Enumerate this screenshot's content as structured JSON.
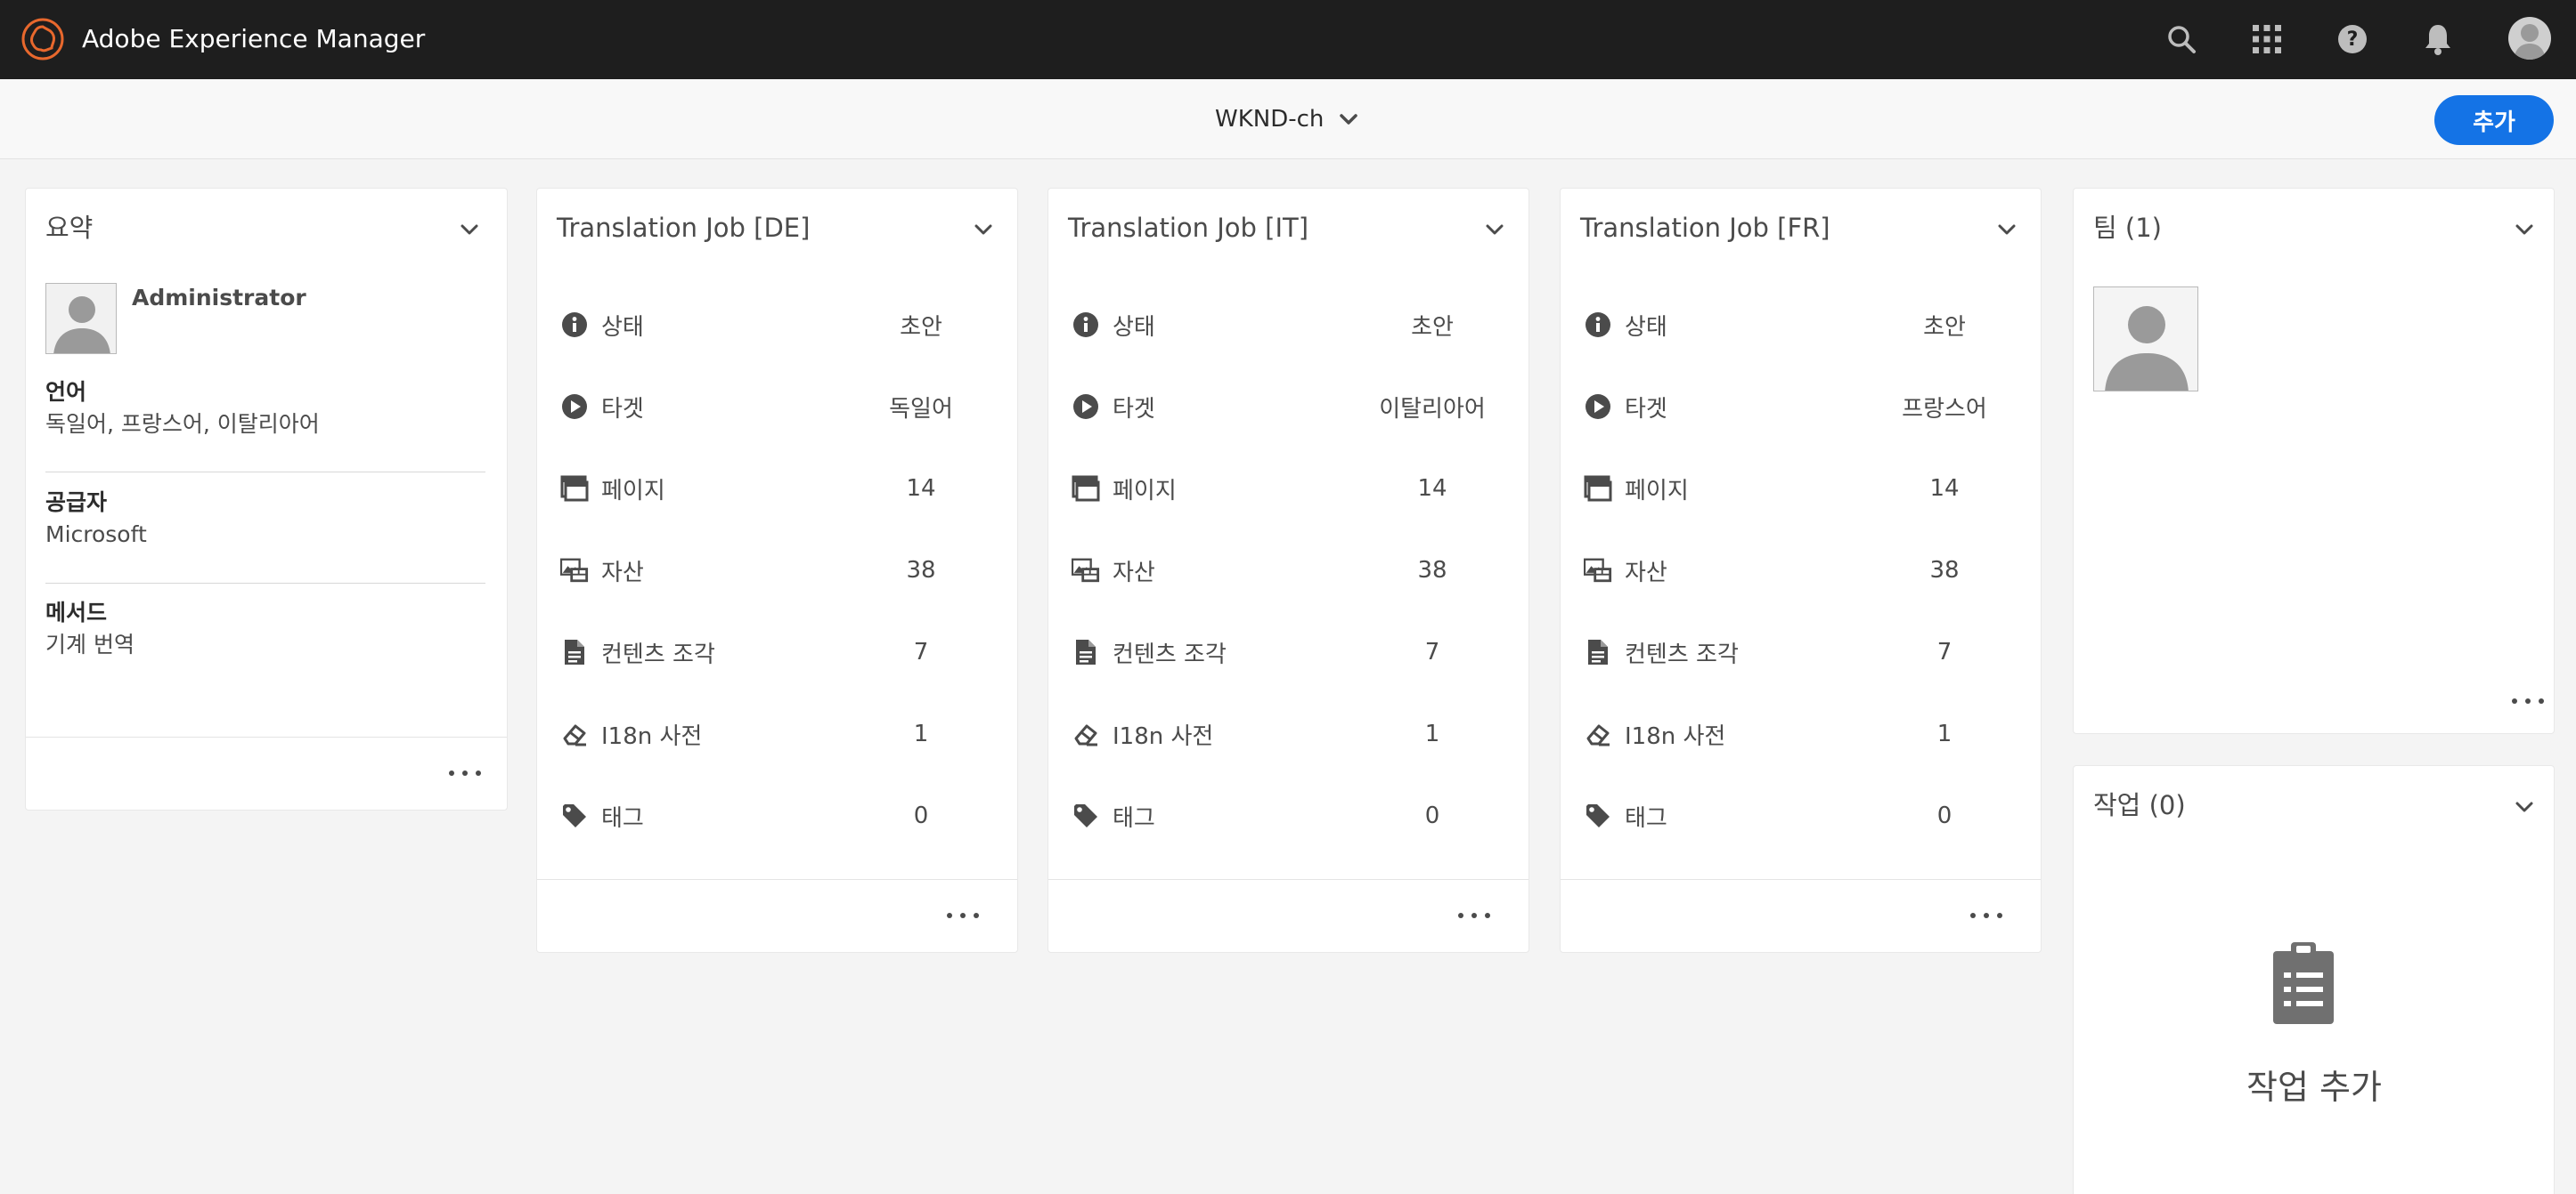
{
  "app": {
    "title": "Adobe Experience Manager"
  },
  "shell_icons": [
    "search-icon",
    "apps-grid-icon",
    "help-icon",
    "notifications-bell-icon",
    "user-avatar"
  ],
  "project": {
    "name": "WKND-ch"
  },
  "actions": {
    "add_label": "추가"
  },
  "summary": {
    "title": "요약",
    "user_name": "Administrator",
    "sections": [
      {
        "label": "언어",
        "value": "독일어, 프랑스어, 이탈리아어"
      },
      {
        "label": "공급자",
        "value": "Microsoft"
      },
      {
        "label": "메서드",
        "value": "기계 번역"
      }
    ]
  },
  "row_labels": {
    "status": "상태",
    "target": "타겟",
    "pages": "페이지",
    "assets": "자산",
    "fragments": "컨텐츠 조각",
    "i18n": "I18n 사전",
    "tags": "태그"
  },
  "jobs": [
    {
      "title": "Translation Job [DE]",
      "status": "초안",
      "target": "독일어",
      "pages": "14",
      "assets": "38",
      "fragments": "7",
      "i18n": "1",
      "tags": "0"
    },
    {
      "title": "Translation Job [IT]",
      "status": "초안",
      "target": "이탈리아어",
      "pages": "14",
      "assets": "38",
      "fragments": "7",
      "i18n": "1",
      "tags": "0"
    },
    {
      "title": "Translation Job [FR]",
      "status": "초안",
      "target": "프랑스어",
      "pages": "14",
      "assets": "38",
      "fragments": "7",
      "i18n": "1",
      "tags": "0"
    }
  ],
  "team": {
    "title": "팀 (1)"
  },
  "tasks": {
    "title": "작업 (0)",
    "empty_label": "작업 추가"
  },
  "colors": {
    "shell": "#1e1e1e",
    "accent": "#1473e6",
    "background": "#f4f4f4",
    "logo": "#e8682d"
  }
}
